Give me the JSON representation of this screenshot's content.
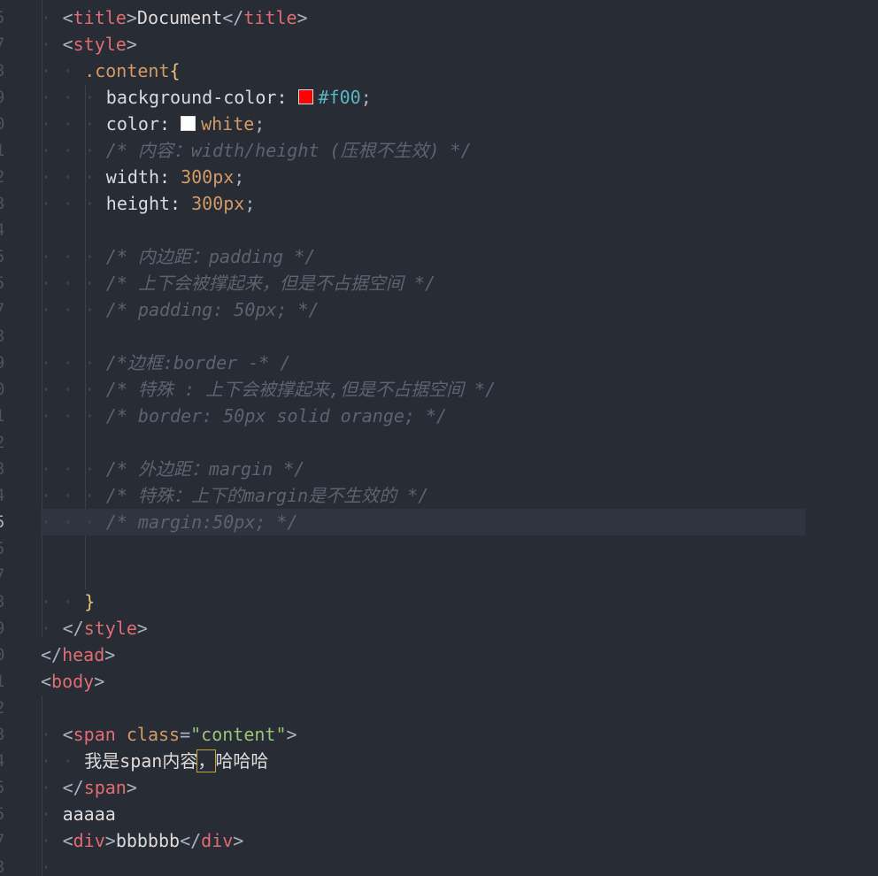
{
  "colors": {
    "background": "#282c34",
    "active_line": "#2f343e",
    "tag": "#e06c75",
    "string": "#98c379",
    "number": "#d19a66",
    "hex": "#56b6c2",
    "comment": "#5c6370",
    "swatch_red": "#ff0000",
    "swatch_white": "#ffffff"
  },
  "line_numbers": [
    "5",
    "7",
    "3",
    "9",
    "0",
    "1",
    "2",
    "3",
    "4",
    "5",
    "5",
    "7",
    "3",
    "9",
    "0",
    "1",
    "2",
    "3",
    "4",
    "5",
    "5",
    "7",
    "3",
    "9",
    "0",
    "1",
    "2",
    "3",
    "4",
    "5",
    "5",
    "7",
    "3"
  ],
  "active_line_index": 19,
  "code": {
    "l0": [
      "<",
      "title",
      ">",
      "Document",
      "</",
      "title",
      ">"
    ],
    "l1": [
      "<",
      "style",
      ">"
    ],
    "l2": [
      ".content",
      "{"
    ],
    "l3": [
      "background-color: ",
      "#f00",
      ";"
    ],
    "l4": [
      "color: ",
      "white",
      ";"
    ],
    "l5": "/* 内容：width/height (压根不生效) */",
    "l6": [
      "width: ",
      "300px",
      ";"
    ],
    "l7": [
      "height: ",
      "300px",
      ";"
    ],
    "l9": "/* 内边距：padding */",
    "l10": "/* 上下会被撑起来，但是不占据空间 */",
    "l11": "/* padding: 50px; */",
    "l13": "/*边框:border -* /",
    "l14": "/* 特殊 : 上下会被撑起来,但是不占据空间 */",
    "l15": "/* border: 50px solid orange; */",
    "l17": "/* 外边距：margin */",
    "l18": "/* 特殊：上下的margin是不生效的 */",
    "l19": "/* margin:50px; */",
    "l22": "}",
    "l23": [
      "</",
      "style",
      ">"
    ],
    "l24": [
      "</",
      "head",
      ">"
    ],
    "l25": [
      "<",
      "body",
      ">"
    ],
    "l27": [
      "<",
      "span",
      " ",
      "class",
      "=",
      "\"content\"",
      ">"
    ],
    "l28": [
      "我是span内容",
      "，",
      "哈哈哈"
    ],
    "l29": [
      "</",
      "span",
      ">"
    ],
    "l30": "aaaaa",
    "l31": [
      "<",
      "div",
      ">",
      "bbbbbb",
      "</",
      "div",
      ">"
    ]
  }
}
